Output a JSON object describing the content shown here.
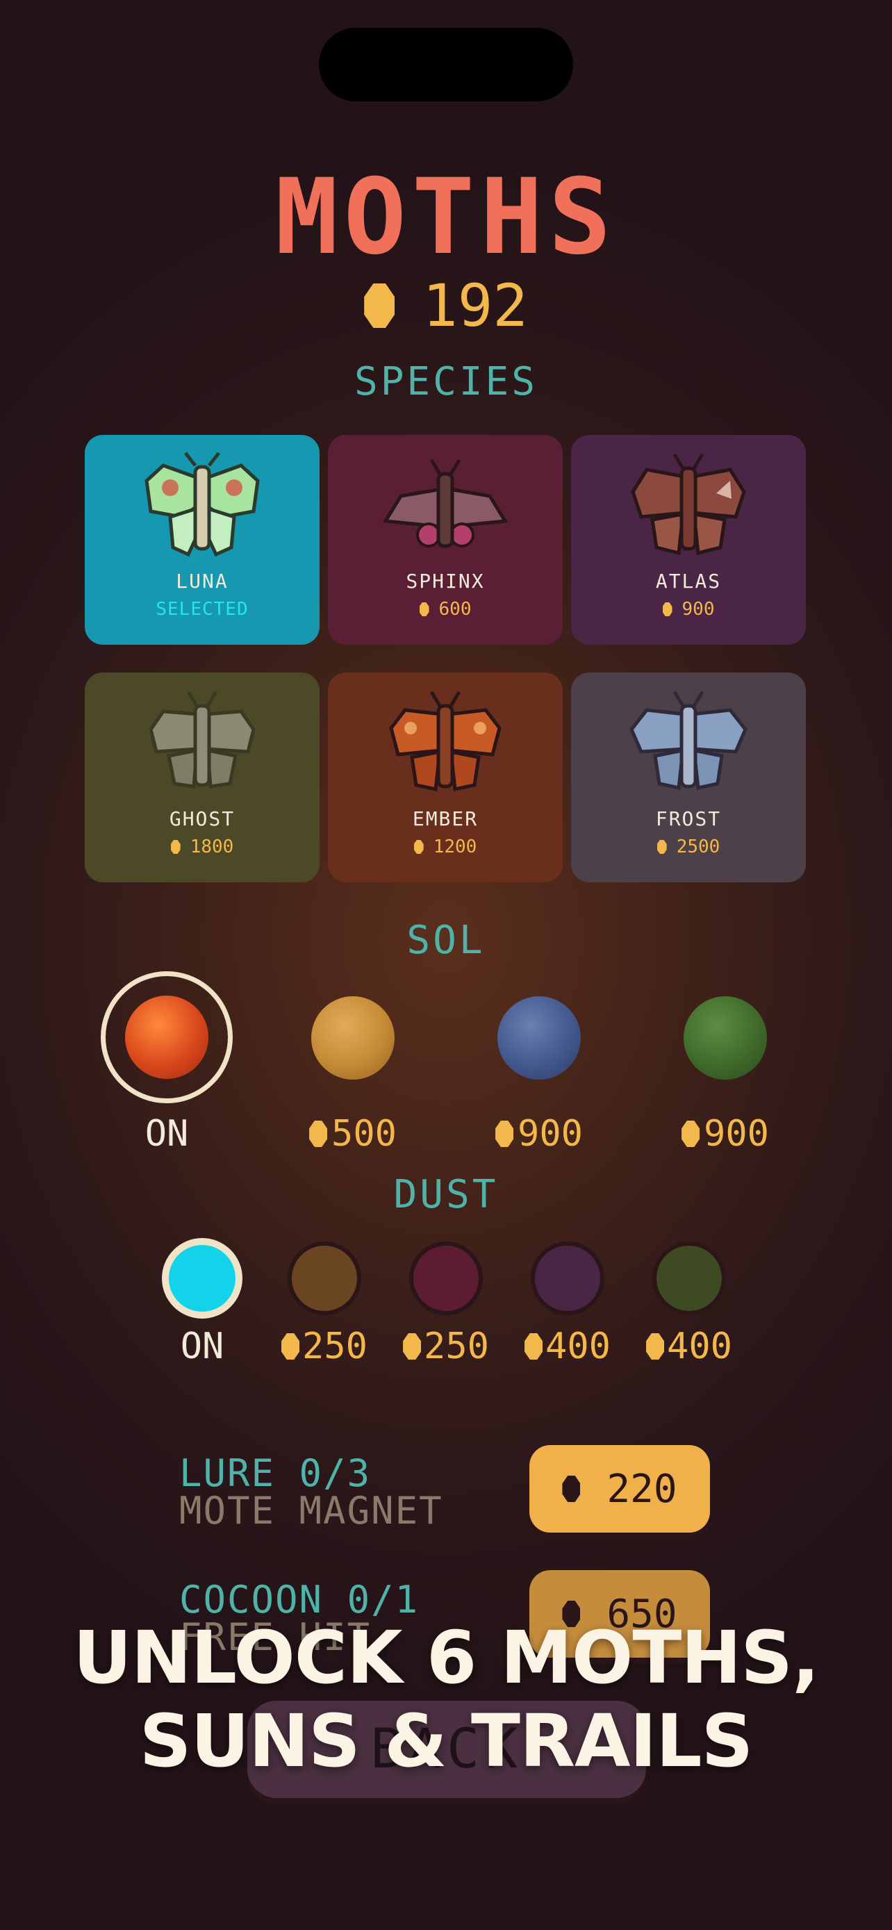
{
  "screen": {
    "title": "MOTHS",
    "balance": "192",
    "icons": {
      "currency": "coin-icon"
    }
  },
  "species": {
    "heading": "SPECIES",
    "items": [
      {
        "name": "LUNA",
        "status": "SELECTED",
        "color": "#1598b0"
      },
      {
        "name": "SPHINX",
        "price": "600",
        "color": "#5a1f35"
      },
      {
        "name": "ATLAS",
        "price": "900",
        "color": "#4a2545"
      },
      {
        "name": "GHOST",
        "price": "1800",
        "color": "#4c4a26"
      },
      {
        "name": "EMBER",
        "price": "1200",
        "color": "#6a2e1d"
      },
      {
        "name": "FROST",
        "price": "2500",
        "color": "#4e4048"
      }
    ]
  },
  "sol": {
    "heading": "SOL",
    "items": [
      {
        "label": "ON",
        "color": "#e0541f"
      },
      {
        "price": "500",
        "color": "#c58a36"
      },
      {
        "price": "900",
        "color": "#43588d"
      },
      {
        "price": "900",
        "color": "#3f6a2a"
      }
    ]
  },
  "dust": {
    "heading": "DUST",
    "items": [
      {
        "label": "ON",
        "color": "#12d3ea"
      },
      {
        "price": "250",
        "color": "#6a4522"
      },
      {
        "price": "250",
        "color": "#5e1c33"
      },
      {
        "price": "400",
        "color": "#4a2646"
      },
      {
        "price": "400",
        "color": "#3e4a22"
      }
    ]
  },
  "upgrades": [
    {
      "title": "LURE 0/3",
      "subtitle": "MOTE MAGNET",
      "price": "220"
    },
    {
      "title": "COCOON 0/1",
      "subtitle": "FREE HIT",
      "price": "650"
    }
  ],
  "bottom_button": {
    "label": "BACK"
  },
  "banner": {
    "line1": "UNLOCK 6 MOTHS,",
    "line2": "SUNS & TRAILS"
  }
}
